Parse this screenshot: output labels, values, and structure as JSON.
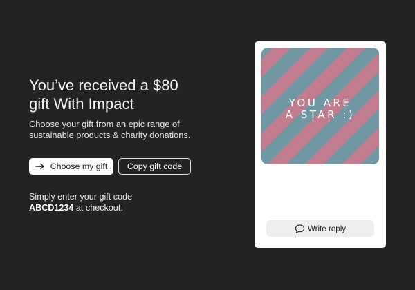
{
  "gift": {
    "headline_line1": "You’ve received a $80",
    "headline_line2": "gift With Impact",
    "subtext_line1": "Choose your gift from an epic range of",
    "subtext_line2": "sustainable products & charity donations."
  },
  "actions": {
    "choose_label": "Choose my gift",
    "copy_label": "Copy gift code"
  },
  "code_info": {
    "line1": "Simply enter your gift code",
    "code": "ABCD1234",
    "line2_suffix": " at checkout."
  },
  "card": {
    "image_text_line1": "YOU ARE",
    "image_text_line2": "A STAR :)",
    "reply_label": "Write reply"
  },
  "icons": {
    "choose_button_icon": "arrow-right-icon",
    "reply_button_icon": "speech-bubble-icon"
  },
  "colors": {
    "background": "#232323",
    "stripe_blue": "#6f97a4",
    "stripe_pink": "#c17d8f",
    "card": "#ffffff"
  }
}
